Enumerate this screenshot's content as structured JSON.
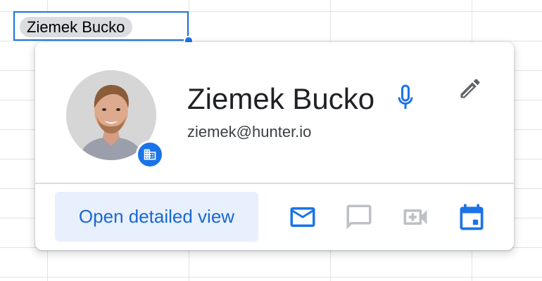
{
  "cell": {
    "chip_label": "Ziemek Bucko"
  },
  "card": {
    "name": "Ziemek Bucko",
    "email": "ziemek@hunter.io",
    "open_button_label": "Open detailed view",
    "icons": {
      "avatar": "user-photo",
      "badge": "organization-building-icon",
      "mic": "microphone-icon",
      "edit": "pencil-icon",
      "mail": "mail-icon",
      "chat": "chat-icon",
      "video": "video-call-icon",
      "calendar": "calendar-icon"
    }
  },
  "colors": {
    "accent": "#1a73e8",
    "button_bg": "#e8f0fe",
    "disabled_icon": "#bdc1c6",
    "chip_bg": "#dadce0"
  }
}
